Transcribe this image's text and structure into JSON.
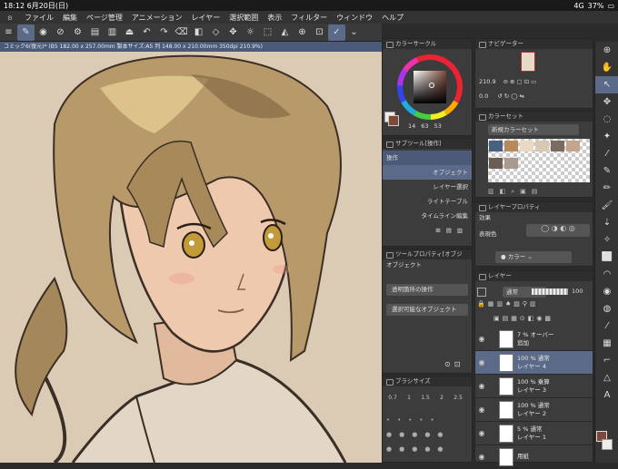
{
  "status": {
    "time": "18:12",
    "date": "6月20日(日)",
    "signal": "4G",
    "battery": "37%"
  },
  "menu": {
    "items": [
      "ファイル",
      "編集",
      "ページ管理",
      "アニメーション",
      "レイヤー",
      "選択範囲",
      "表示",
      "フィルター",
      "ウィンドウ",
      "ヘルプ"
    ]
  },
  "toolbar": {
    "icons": [
      "menu-icon",
      "pen-tool-icon",
      "eye-icon",
      "lasso-icon",
      "gear-icon",
      "document-icon",
      "trash-icon",
      "snapshot-icon",
      "undo-icon",
      "redo-icon",
      "clear-icon",
      "fill-icon",
      "transform-icon",
      "move-icon",
      "flip-icon",
      "ruler-icon",
      "canvas-rotate-icon",
      "zoom-icon",
      "checkmark-icon",
      "drawing-check-icon",
      "chevron-down-icon"
    ]
  },
  "document": {
    "tab_title": "コミック6(復元)* (B5 182.00 x 257.00mm 製本サイズ:A5 判 148.00 x 210.00mm 350dpi 210.9%)"
  },
  "color_circle": {
    "title": "カラーサークル",
    "h": "14",
    "s": "63",
    "v": "53",
    "accent": "#7d4a3a"
  },
  "navigator": {
    "title": "ナビゲーター",
    "zoom": "210.9",
    "rotation": "0.0"
  },
  "color_set": {
    "title": "カラーセット",
    "set_name": "新規カラーセット",
    "swatches": [
      "#4a6080",
      "#b88a5a",
      "#e9d8c3",
      "#d8c7b3",
      "#7a6a60",
      "#c4a58c",
      "#6b5d54",
      "#a89a8f"
    ]
  },
  "sub_tool": {
    "title": "サブツール[操作]",
    "group": "操作",
    "items": [
      "オブジェクト",
      "レイヤー選択",
      "ライトテーブル",
      "タイムライン編集"
    ]
  },
  "layer_property": {
    "title": "レイヤープロパティ",
    "effect_label": "効果",
    "expression_label": "表現色",
    "expression_value": "カラー"
  },
  "tool_property": {
    "title": "ツールプロパティ[オブジ",
    "object_label": "オブジェクト",
    "transparent_op": "透明箇所の操作",
    "selectable_obj": "選択可能なオブジェクト"
  },
  "brush_size": {
    "title": "ブラシサイズ",
    "values": [
      "0.7",
      "1",
      "1.5",
      "2",
      "2.5"
    ]
  },
  "layers": {
    "title": "レイヤー",
    "blend_mode": "通常",
    "opacity": "100",
    "items": [
      {
        "line1": "7 % オーバー",
        "line2": "追加",
        "selected": false
      },
      {
        "line1": "100 % 通常",
        "line2": "レイヤー 4",
        "selected": true
      },
      {
        "line1": "100 % 乗算",
        "line2": "レイヤー 3",
        "selected": false
      },
      {
        "line1": "100 % 通常",
        "line2": "レイヤー 2",
        "selected": false
      },
      {
        "line1": "5 % 通常",
        "line2": "レイヤー 1",
        "selected": false
      },
      {
        "line1": "",
        "line2": "用紙",
        "selected": false
      }
    ]
  },
  "right_tools": {
    "icons": [
      "zoom-icon",
      "hand-icon",
      "operation-icon",
      "move-layer-icon",
      "lasso-select-icon",
      "auto-select-icon",
      "eyedropper-icon",
      "pen-icon",
      "pencil-icon",
      "brush-icon",
      "airbrush-icon",
      "decoration-icon",
      "eraser-icon",
      "blend-icon",
      "fill-icon",
      "gradient-icon",
      "figure-icon",
      "frame-icon",
      "ruler-icon",
      "text-icon",
      "speech-balloon-icon"
    ]
  },
  "colors": {
    "main": "#7d4a3a",
    "sub": "#f0ede8",
    "accent": "#5a6a88"
  }
}
